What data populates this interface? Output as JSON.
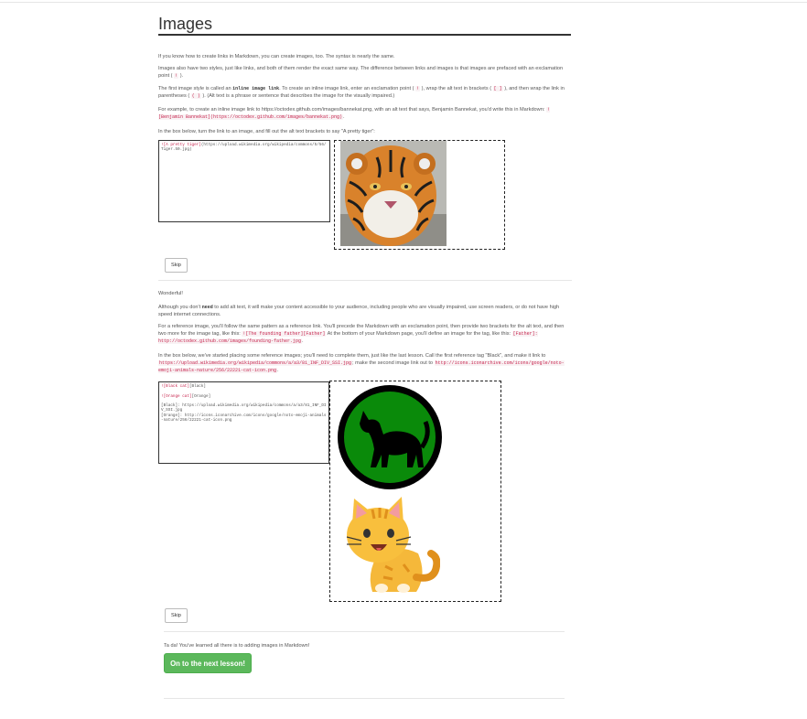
{
  "page_title": "Images",
  "intro": {
    "p1": "If you know how to create links in Markdown, you can create images, too. The syntax is nearly the same.",
    "p2_a": "Images also have two styles, just like links, and both of them render the exact same way. The difference between links and images is that images are prefaced with an exclamation point (",
    "p2_code": "!",
    "p2_b": ").",
    "p3_a": "The first image style is called an ",
    "p3_strong": "inline image link",
    "p3_b": ". To create an inline image link, enter an exclamation point (",
    "p3_code1": "!",
    "p3_c": "), wrap the alt text in brackets (",
    "p3_code2": "[ ]",
    "p3_d": "), and then wrap the link in parentheses (",
    "p3_code3": "( )",
    "p3_e": "). (Alt text is a phrase or sentence that describes the image for the visually impaired.)",
    "p4_a": "For example, to create an inline image link to https://octodex.github.com/images/bannekat.png, with an alt text that says, Benjamin Bannekat, you'd write this in Markdown: ",
    "p4_code": "![Benjamin Bannekat](https://octodex.github.com/images/bannekat.png)",
    "p4_b": ".",
    "p5": "In the box below, turn the link to an image, and fill out the alt text brackets to say \"A pretty tiger\":"
  },
  "editor1": {
    "alt": "![A pretty tiger]",
    "url": "(https://upload.wikimedia.org/wikipedia/commons/5/56/Tiger.50.jpg)"
  },
  "skip_label": "Skip",
  "section2": {
    "wonderful": "Wonderful!",
    "p1_a": "Although you don't ",
    "p1_strong": "need",
    "p1_b": " to add alt text, it will make your content accessible to your audience, including people who are visually impaired, use screen readers, or do not have high speed internet connections.",
    "p2_a": "For a reference image, you'll follow the same pattern as a reference link. You'll precede the Markdown with an exclamation point, then provide two brackets for the alt text, and then two more for the image tag, like this: ",
    "p2_code1": "![The founding father][Father]",
    "p2_b": " At the bottom of your Markdown page, you'll define an image for the tag, like this: ",
    "p2_code2": "[Father]: http://octodex.github.com/images/founding-father.jpg",
    "p2_c": ".",
    "p3_a": "In the box below, we've started placing some reference images; you'll need to complete them, just like the last lesson. Call the first reference tag \"Black\", and make it link to ",
    "p3_code1": "https://upload.wikimedia.org/wikipedia/commons/a/a3/81_INF_DIV_SSI.jpg",
    "p3_b": "; make the second image link out to ",
    "p3_code2": "http://icons.iconarchive.com/icons/google/noto-emoji-animals-nature/256/22221-cat-icon.png",
    "p3_c": "."
  },
  "editor2": {
    "line1_alt": "![Black cat]",
    "line1_ref": "[Black]",
    "line2_alt": "![Orange cat]",
    "line2_ref": "[Orange]",
    "line3": "[Black]: https://upload.wikimedia.org/wikipedia/commons/a/a3/81_INF_DIV_SSI.jpg",
    "line4": "[Orange]: http://icons.iconarchive.com/icons/google/noto-emoji-animals-nature/256/22221-cat-icon.png"
  },
  "finish": {
    "text": "Ta da! You've learned all there is to adding images in Markdown!",
    "next_button": "On to the next lesson!"
  },
  "colors": {
    "accent_green": "#5cb85c",
    "code_red": "#c7254e",
    "patch_green": "#0a8a0a"
  },
  "icons": {
    "tiger_image": "tiger-photo",
    "black_cat_patch": "black-cat-insignia",
    "orange_cat": "orange-cat-emoji"
  }
}
